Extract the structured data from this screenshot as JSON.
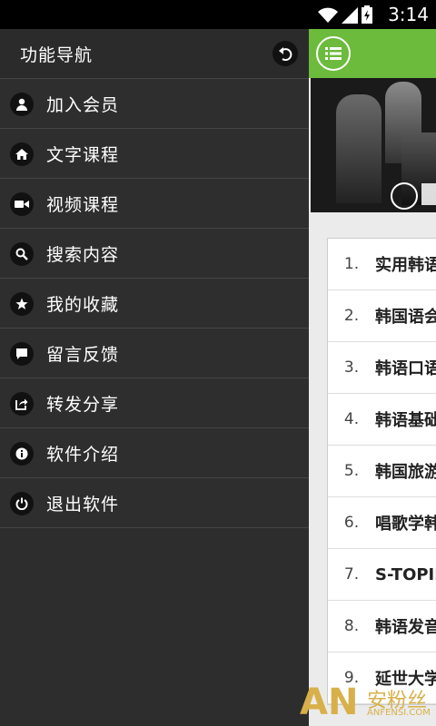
{
  "status": {
    "time": "3:14"
  },
  "drawer": {
    "title": "功能导航",
    "items": [
      {
        "label": "加入会员",
        "icon": "person-icon"
      },
      {
        "label": "文字课程",
        "icon": "home-icon"
      },
      {
        "label": "视频课程",
        "icon": "video-icon"
      },
      {
        "label": "搜索内容",
        "icon": "search-icon"
      },
      {
        "label": "我的收藏",
        "icon": "star-icon"
      },
      {
        "label": "留言反馈",
        "icon": "chat-icon"
      },
      {
        "label": "转发分享",
        "icon": "share-icon"
      },
      {
        "label": "软件介绍",
        "icon": "info-icon"
      },
      {
        "label": "退出软件",
        "icon": "power-icon"
      }
    ]
  },
  "content": {
    "accent": "#6cbb3c",
    "rows": [
      {
        "num": "1.",
        "title": "实用韩语"
      },
      {
        "num": "2.",
        "title": "韩国语会"
      },
      {
        "num": "3.",
        "title": "韩语口语"
      },
      {
        "num": "4.",
        "title": "韩语基础"
      },
      {
        "num": "5.",
        "title": "韩国旅游"
      },
      {
        "num": "6.",
        "title": "唱歌学韩"
      },
      {
        "num": "7.",
        "title": "S-TOPIK"
      },
      {
        "num": "8.",
        "title": "韩语发音"
      },
      {
        "num": "9.",
        "title": "延世大学"
      }
    ]
  },
  "watermark": {
    "logo": "AN",
    "cn": "安粉丝",
    "en": "ANFENSI.COM"
  }
}
